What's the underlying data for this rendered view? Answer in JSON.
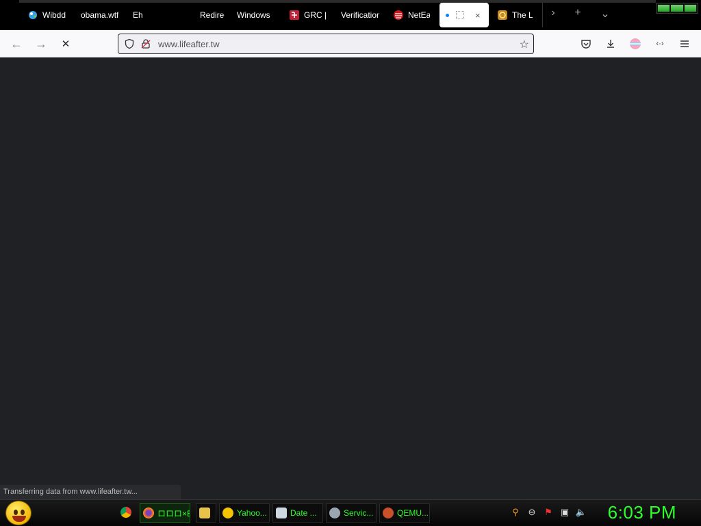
{
  "tabs": [
    {
      "label": "Wibdd",
      "favicon": "globe-icon"
    },
    {
      "label": "obama.wtf",
      "favicon": ""
    },
    {
      "label": "Eh",
      "favicon": ""
    },
    {
      "label": "Redirec",
      "favicon": ""
    },
    {
      "label": "Windows",
      "favicon": ""
    },
    {
      "label": "GRC |",
      "favicon": "grc-icon"
    },
    {
      "label": "Verification",
      "favicon": ""
    },
    {
      "label": "NetEa",
      "favicon": "netease-icon"
    },
    {
      "label": "The L",
      "favicon": "lifeafter-icon"
    }
  ],
  "active_tab": {
    "close_label": "×"
  },
  "tab_controls": {
    "scroll_right": "›",
    "new_tab": "+",
    "list_all": "⌄"
  },
  "nav": {
    "back": "←",
    "forward": "→",
    "stop": "✕",
    "url": "www.lifeafter.tw"
  },
  "status": {
    "text": "Transferring data from www.lifeafter.tw..."
  },
  "taskbar": {
    "items": [
      {
        "label": "ロロロ×E...",
        "icon": "firefox-icon"
      },
      {
        "label": "",
        "icon": "folder-icon"
      },
      {
        "label": "Yahoo...",
        "icon": "yahoo-messenger-icon"
      },
      {
        "label": "Date ...",
        "icon": "date-time-icon"
      },
      {
        "label": "Servic...",
        "icon": "gear-icon"
      },
      {
        "label": "QEMU...",
        "icon": "qemu-icon"
      }
    ],
    "clock": "6:03 PM"
  },
  "colors": {
    "page_bg": "#1f2124",
    "taskbar_text": "#2dff2d",
    "active_tab_bg": "#ffffff",
    "loading_dot": "#0a84ff"
  }
}
